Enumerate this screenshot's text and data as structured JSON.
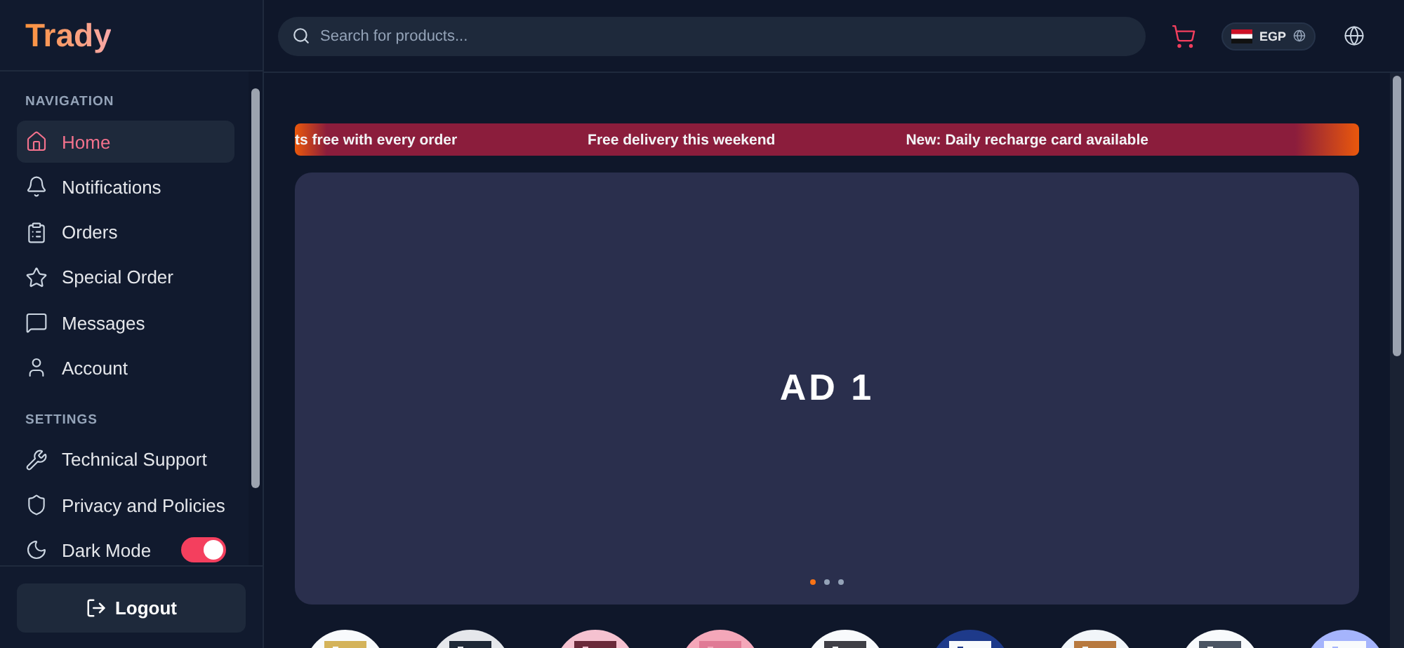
{
  "brand": "Trady",
  "sidebar": {
    "sections": [
      {
        "title": "NAVIGATION",
        "items": [
          {
            "kind": "home",
            "label": "Home",
            "selected": true
          },
          {
            "kind": "bell",
            "label": "Notifications",
            "selected": false
          },
          {
            "kind": "clipboard",
            "label": "Orders",
            "selected": false
          },
          {
            "kind": "star",
            "label": "Special Order",
            "selected": false
          },
          {
            "kind": "message",
            "label": "Messages",
            "selected": false
          },
          {
            "kind": "user",
            "label": "Account",
            "selected": false
          }
        ]
      },
      {
        "title": "SETTINGS",
        "items": [
          {
            "kind": "wrench",
            "label": "Technical Support",
            "selected": false
          },
          {
            "kind": "shield",
            "label": "Privacy and Policies",
            "selected": false
          },
          {
            "kind": "moon",
            "label": "Dark Mode",
            "selected": false,
            "toggle": {
              "on": true
            }
          }
        ]
      }
    ],
    "logout": "Logout"
  },
  "search": {
    "placeholder": "Search for products..."
  },
  "currency": "EGP",
  "ticker": [
    "ts free with every order",
    "Free delivery this weekend",
    "New: Daily recharge card available"
  ],
  "ad": {
    "title": "AD 1",
    "dots": [
      {
        "selected": true
      },
      {
        "selected": false
      },
      {
        "selected": false
      }
    ]
  }
}
